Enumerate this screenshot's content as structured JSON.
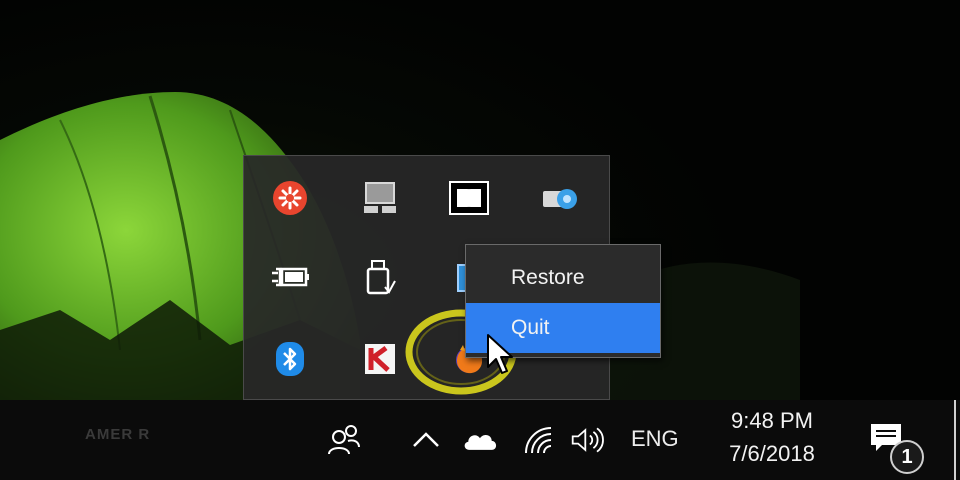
{
  "overflow_tray": {
    "icons": [
      {
        "name": "antivirus-shield-icon",
        "color": "#e8452e"
      },
      {
        "name": "display-monitor-icon",
        "color": "#cfcfcf"
      },
      {
        "name": "dolby-audio-icon",
        "color": "#ffffff"
      },
      {
        "name": "network-drive-icon",
        "color": "#3aa0e8"
      },
      {
        "name": "battery-plugged-icon",
        "color": "#ffffff"
      },
      {
        "name": "usb-safely-remove-icon",
        "color": "#ffffff"
      },
      {
        "name": "app-window-icon",
        "color": "#2f8fd8"
      },
      {
        "name": "bluetooth-icon",
        "color": "#1f8be8"
      },
      {
        "name": "kaspersky-icon",
        "color": "#d0202a"
      },
      {
        "name": "firefox-icon",
        "color": "#f07a1a"
      }
    ]
  },
  "context_menu": {
    "items": [
      {
        "label": "Restore",
        "highlighted": false
      },
      {
        "label": "Quit",
        "highlighted": true
      }
    ],
    "highlight_color": "#2f7ff0"
  },
  "taskbar": {
    "watermark": "AMER R",
    "language": "ENG",
    "clock": {
      "time": "9:48 PM",
      "date": "7/6/2018"
    },
    "notification_count": "1",
    "icons": [
      "people-icon",
      "show-hidden-icons-chevron-icon",
      "onedrive-cloud-icon",
      "wifi-icon",
      "volume-icon",
      "action-center-icon"
    ]
  }
}
